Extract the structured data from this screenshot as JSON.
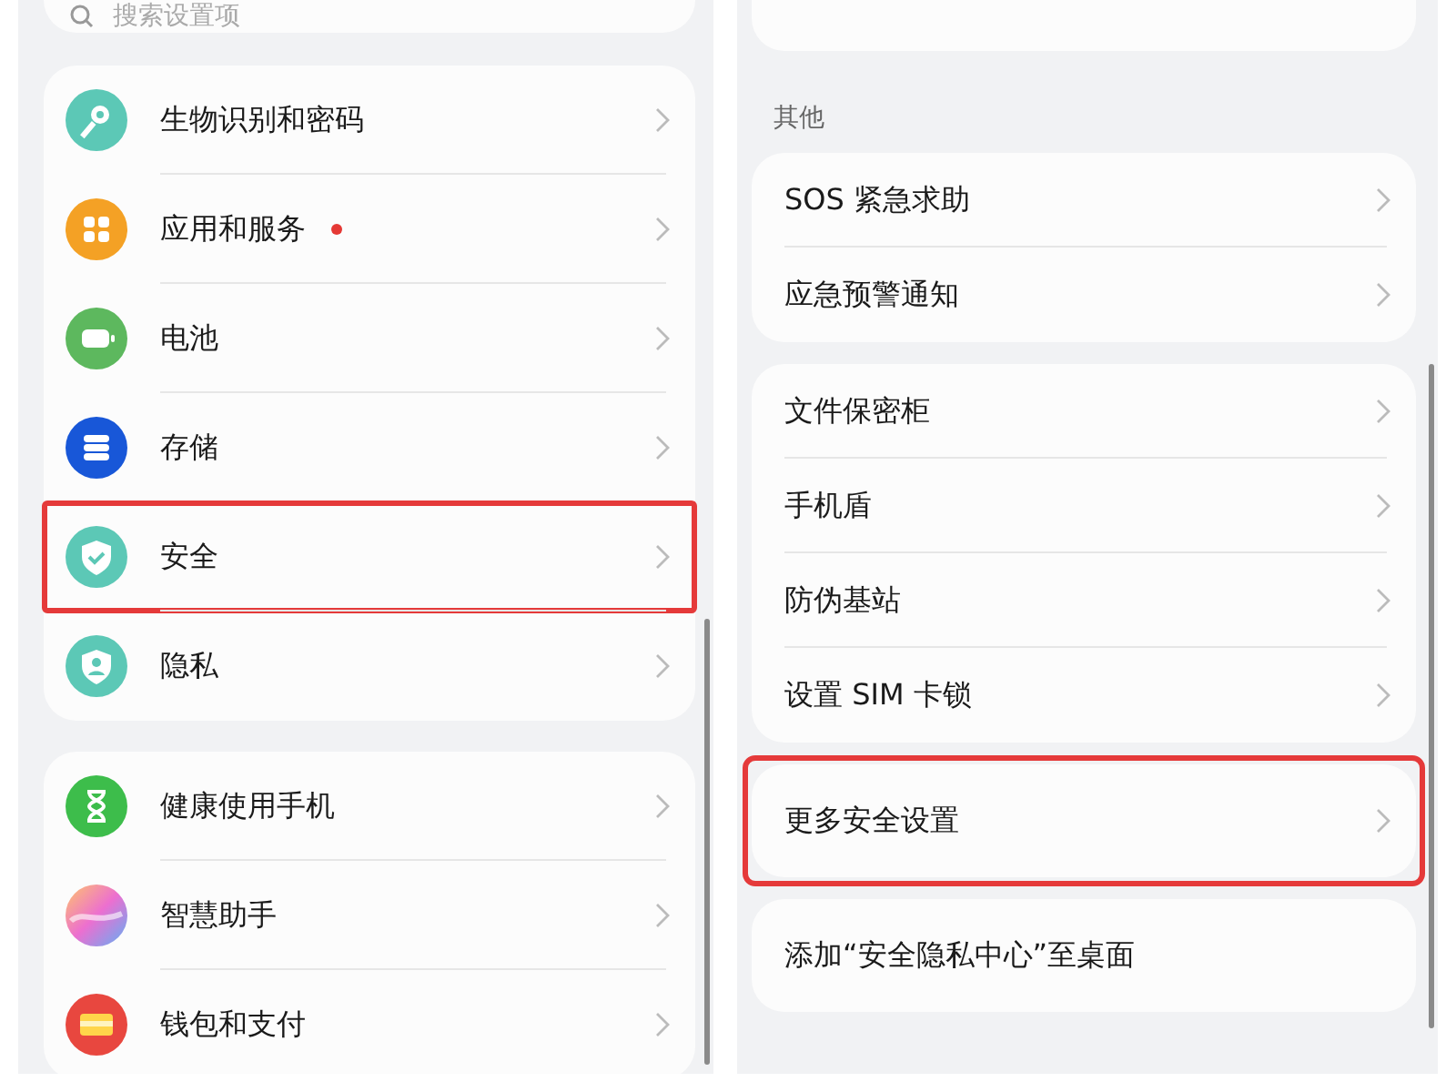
{
  "left_screen": {
    "search": {
      "placeholder": "搜索设置项"
    },
    "groups": [
      {
        "items": [
          {
            "label": "生物识别和密码",
            "kind": "key",
            "dot": false,
            "highlighted": false
          },
          {
            "label": "应用和服务",
            "kind": "apps",
            "dot": true,
            "highlighted": false
          },
          {
            "label": "电池",
            "kind": "battery",
            "dot": false,
            "highlighted": false
          },
          {
            "label": "存储",
            "kind": "storage",
            "dot": false,
            "highlighted": false
          },
          {
            "label": "安全",
            "kind": "security",
            "dot": false,
            "highlighted": true
          },
          {
            "label": "隐私",
            "kind": "privacy",
            "dot": false,
            "highlighted": false
          }
        ]
      },
      {
        "items": [
          {
            "label": "健康使用手机",
            "kind": "hourglass",
            "dot": false,
            "highlighted": false
          },
          {
            "label": "智慧助手",
            "kind": "assistant",
            "dot": false,
            "highlighted": false
          },
          {
            "label": "钱包和支付",
            "kind": "wallet",
            "dot": false,
            "highlighted": false
          }
        ]
      }
    ]
  },
  "right_screen": {
    "section_title": "其他",
    "groups": [
      {
        "items": [
          {
            "label": "SOS 紧急求助",
            "highlighted": false
          },
          {
            "label": "应急预警通知",
            "highlighted": false
          }
        ]
      },
      {
        "items": [
          {
            "label": "文件保密柜",
            "highlighted": false
          },
          {
            "label": "手机盾",
            "highlighted": false
          },
          {
            "label": "防伪基站",
            "highlighted": false
          },
          {
            "label": "设置 SIM 卡锁",
            "highlighted": false
          }
        ]
      },
      {
        "items": [
          {
            "label": "更多安全设置",
            "highlighted": true
          }
        ]
      },
      {
        "items": [
          {
            "label": "添加“安全隐私中心”至桌面",
            "highlighted": false,
            "chevron": false
          }
        ]
      }
    ]
  }
}
